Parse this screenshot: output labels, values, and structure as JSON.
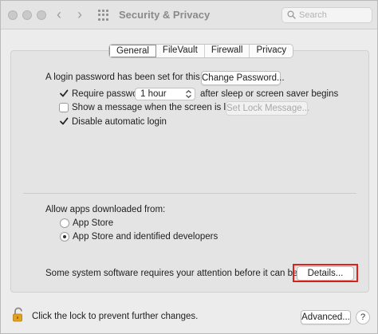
{
  "window": {
    "title": "Security & Privacy",
    "search_placeholder": "Search"
  },
  "tabs": [
    {
      "label": "General",
      "active": true
    },
    {
      "label": "FileVault",
      "active": false
    },
    {
      "label": "Firewall",
      "active": false
    },
    {
      "label": "Privacy",
      "active": false
    }
  ],
  "general": {
    "login_password_text": "A login password has been set for this user",
    "change_password_label": "Change Password...",
    "require_password_label": "Require password",
    "require_password_checked": true,
    "require_password_delay": "1 hour",
    "require_password_suffix": "after sleep or screen saver begins",
    "show_message_label": "Show a message when the screen is locked",
    "show_message_checked": false,
    "set_lock_message_label": "Set Lock Message...",
    "disable_auto_login_label": "Disable automatic login",
    "disable_auto_login_checked": true
  },
  "allow_apps": {
    "heading": "Allow apps downloaded from:",
    "options": [
      {
        "label": "App Store",
        "selected": false
      },
      {
        "label": "App Store and identified developers",
        "selected": true
      }
    ]
  },
  "system_software": {
    "message": "Some system software requires your attention before it can be used.",
    "details_label": "Details..."
  },
  "footer": {
    "lock_text": "Click the lock to prevent further changes.",
    "advanced_label": "Advanced...",
    "help_label": "?"
  },
  "colors": {
    "highlight_border": "#e0201b",
    "lock_icon": "#e0a21f"
  }
}
